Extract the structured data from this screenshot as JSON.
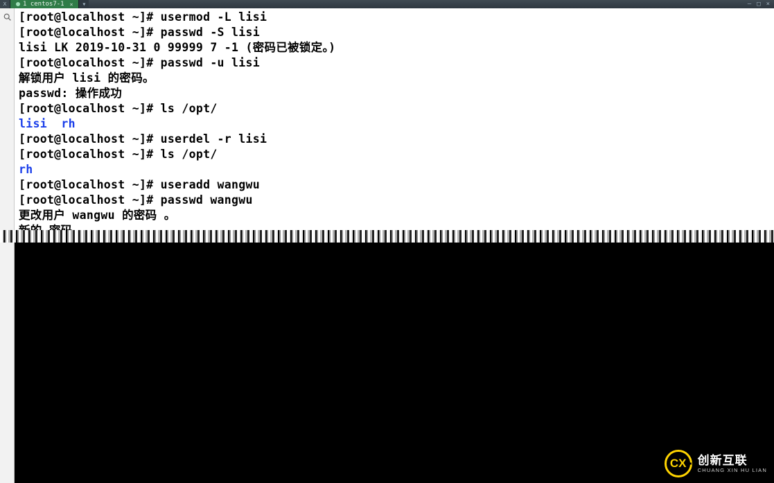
{
  "tabs": {
    "close_icon": "x",
    "active_label": "1 centos7-1",
    "add_icon": "▾"
  },
  "window_controls": {
    "min": "—",
    "max": "□",
    "close": "×"
  },
  "gutter": {
    "search_icon": "search-icon"
  },
  "terminal": {
    "lines": [
      {
        "segments": [
          {
            "text": "[root@localhost ~]# usermod -L lisi",
            "cls": "bld"
          }
        ]
      },
      {
        "segments": [
          {
            "text": "[root@localhost ~]# passwd -S lisi",
            "cls": "bld"
          }
        ]
      },
      {
        "segments": [
          {
            "text": "lisi LK 2019-10-31 0 99999 7 -1 (密码已被锁定。)",
            "cls": "bld"
          }
        ]
      },
      {
        "segments": [
          {
            "text": "[root@localhost ~]# passwd -u lisi",
            "cls": "bld"
          }
        ]
      },
      {
        "segments": [
          {
            "text": "解锁用户 lisi 的密码。",
            "cls": "bld"
          }
        ]
      },
      {
        "segments": [
          {
            "text": "passwd: 操作成功",
            "cls": "bld"
          }
        ]
      },
      {
        "segments": [
          {
            "text": "[root@localhost ~]# ls /opt/",
            "cls": "bld"
          }
        ]
      },
      {
        "segments": [
          {
            "text": "lisi",
            "cls": "blue"
          },
          {
            "text": "  ",
            "cls": "bld"
          },
          {
            "text": "rh",
            "cls": "blue"
          }
        ]
      },
      {
        "segments": [
          {
            "text": "[root@localhost ~]# userdel -r lisi",
            "cls": "bld"
          }
        ]
      },
      {
        "segments": [
          {
            "text": "[root@localhost ~]# ls /opt/",
            "cls": "bld"
          }
        ]
      },
      {
        "segments": [
          {
            "text": "rh",
            "cls": "blue"
          }
        ]
      },
      {
        "segments": [
          {
            "text": "[root@localhost ~]# useradd wangwu",
            "cls": "bld"
          }
        ]
      },
      {
        "segments": [
          {
            "text": "[root@localhost ~]# passwd wangwu",
            "cls": "bld"
          }
        ]
      },
      {
        "segments": [
          {
            "text": "更改用户 wangwu 的密码 。",
            "cls": "bld"
          }
        ]
      },
      {
        "segments": [
          {
            "text": "新的 密码",
            "cls": "bld"
          }
        ]
      }
    ]
  },
  "watermark": {
    "badge": "CX",
    "cn": "创新互联",
    "en": "CHUANG XIN HU LIAN"
  }
}
